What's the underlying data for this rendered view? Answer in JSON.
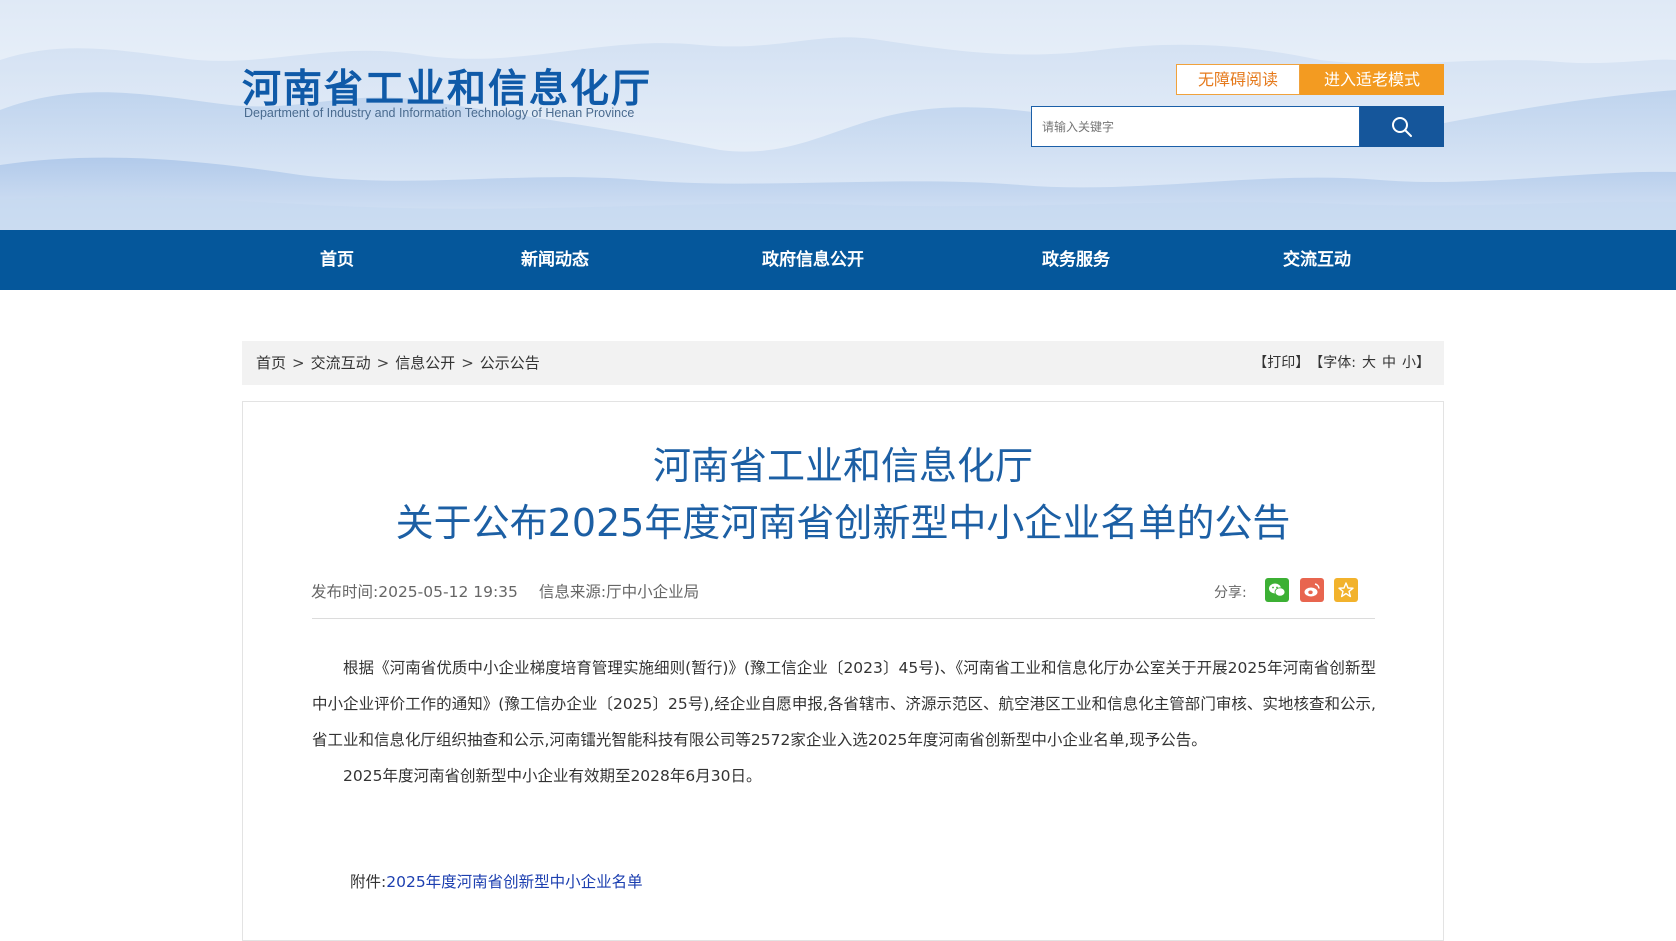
{
  "header": {
    "site_title": "河南省工业和信息化厅",
    "site_subtitle": "Department of Industry and Information Technology of Henan Province",
    "accessibility_label": "无障碍阅读",
    "elder_mode_label": "进入适老模式",
    "search_placeholder": "请输入关键字"
  },
  "nav": {
    "items": [
      "首页",
      "新闻动态",
      "政府信息公开",
      "政务服务",
      "交流互动"
    ]
  },
  "breadcrumb": {
    "items": [
      "首页",
      "交流互动",
      "信息公开",
      "公示公告"
    ],
    "separator": ">"
  },
  "tools": {
    "print": "【打印】",
    "font_label": "【字体:",
    "font_large": "大",
    "font_medium": "中",
    "font_small": "小",
    "font_close": "】"
  },
  "article": {
    "title_line1": "河南省工业和信息化厅",
    "title_line2": "关于公布2025年度河南省创新型中小企业名单的公告",
    "publish_time": "发布时间:2025-05-12 19:35",
    "source": "信息来源:厅中小企业局",
    "share_label": "分享:",
    "paragraphs": [
      "根据《河南省优质中小企业梯度培育管理实施细则(暂行)》(豫工信企业〔2023〕45号)、《河南省工业和信息化厅办公室关于开展2025年河南省创新型中小企业评价工作的通知》(豫工信办企业〔2025〕25号),经企业自愿申报,各省辖市、济源示范区、航空港区工业和信息化主管部门审核、实地核查和公示,省工业和信息化厅组织抽查和公示,河南镭光智能科技有限公司等2572家企业入选2025年度河南省创新型中小企业名单,现予公告。",
      "2025年度河南省创新型中小企业有效期至2028年6月30日。"
    ],
    "attachment_label": "附件:",
    "attachment_link": "2025年度河南省创新型中小企业名单"
  },
  "colors": {
    "nav_bg": "#05579b",
    "title_blue": "#1c5fa4",
    "accent_orange": "#f39b21",
    "wechat_green": "#3cb034",
    "weibo_red": "#e8654f",
    "favorite_yellow": "#f2b22c"
  },
  "icons": {
    "search": "search-icon",
    "wechat": "wechat-icon",
    "weibo": "weibo-icon",
    "favorite": "star-icon"
  }
}
